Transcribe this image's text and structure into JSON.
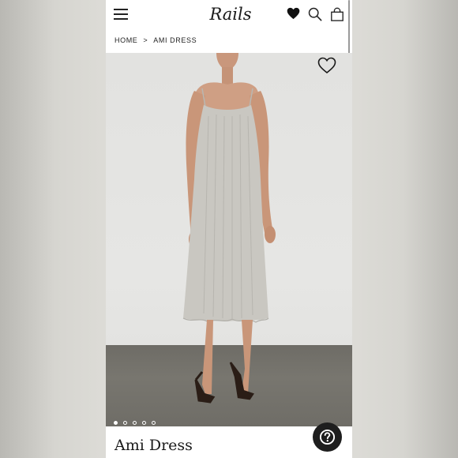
{
  "header": {
    "logo_text": "Rails",
    "menu_icon": "hamburger-menu-icon",
    "wishlist_icon": "heart-filled-icon",
    "search_icon": "search-icon",
    "bag_icon": "shopping-bag-icon"
  },
  "breadcrumb": {
    "home": "HOME",
    "separator": ">",
    "current": "AMI DRESS"
  },
  "product": {
    "name": "Ami Dress",
    "image_alt": "Model wearing a light grey pleated slip midi dress with black strappy heeled sandals",
    "wishlist_icon": "heart-outline-icon",
    "gallery_count": 5,
    "gallery_active_index": 0
  },
  "help_button": {
    "icon": "question-mark-icon"
  },
  "colors": {
    "background": "#ffffff",
    "text": "#1a1a1a",
    "help_button": "#1e1e1e",
    "dress": "#c9c7c1"
  }
}
